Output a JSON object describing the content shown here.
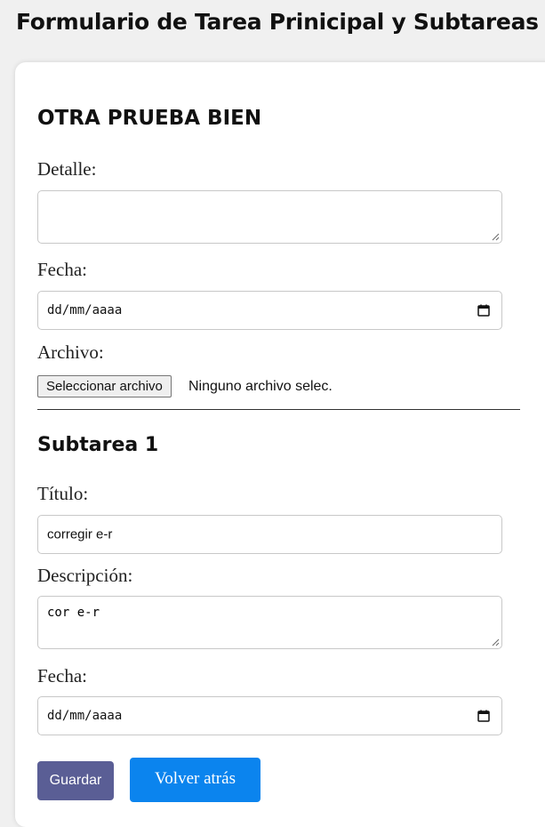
{
  "page": {
    "title": "Formulario de Tarea Prinicipal y Subtareas"
  },
  "task": {
    "title": "OTRA PRUEBA BIEN",
    "detail_label": "Detalle:",
    "detail_value": "",
    "date_label": "Fecha:",
    "date_placeholder": "dd/mm/aaaa",
    "file_label": "Archivo:",
    "file_button": "Seleccionar archivo",
    "file_status": "Ninguno archivo selec."
  },
  "subtask": {
    "heading": "Subtarea 1",
    "title_label": "Título:",
    "title_value": "corregir e-r",
    "description_label": "Descripción:",
    "description_value": "cor e-r",
    "date_label": "Fecha:",
    "date_placeholder": "dd/mm/aaaa"
  },
  "buttons": {
    "save": "Guardar",
    "back": "Volver atrás"
  },
  "colors": {
    "save_button": "#5a5e95",
    "back_button": "#0b84ee",
    "background": "#f0f0f0"
  },
  "icons": {
    "date_picker": "calendar-icon",
    "textarea_resize": "resize-handle-icon"
  }
}
